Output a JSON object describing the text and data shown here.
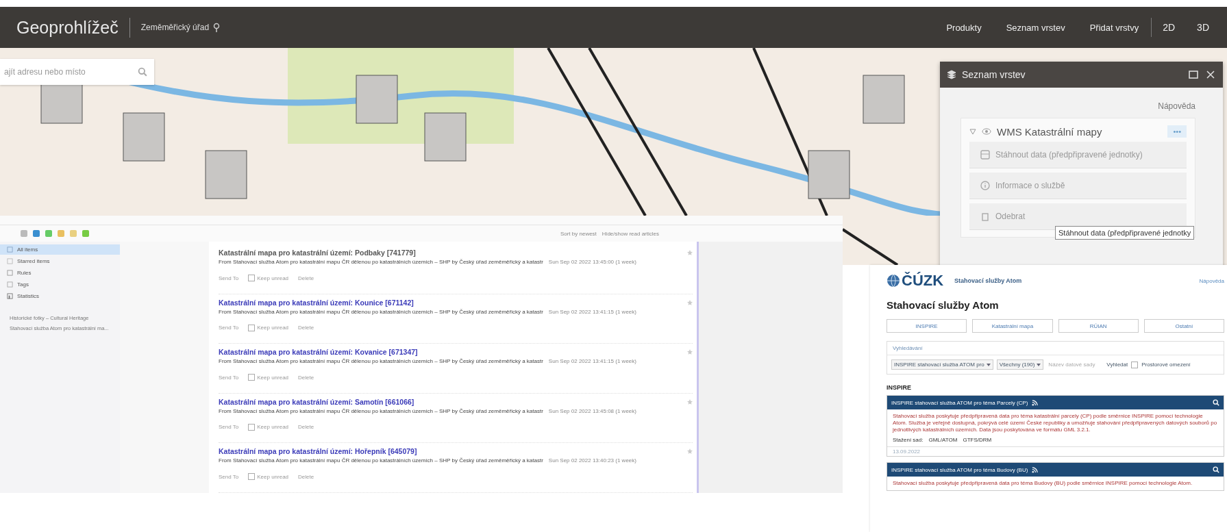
{
  "map_app": {
    "brand": "Geoprohlížeč",
    "organization": "Zeměměřický úřad",
    "nav": [
      {
        "label": "Produkty"
      },
      {
        "label": "Seznam vrstev"
      },
      {
        "label": "Přidat vrstvy"
      }
    ],
    "view_modes": [
      {
        "label": "2D"
      },
      {
        "label": "3D"
      }
    ],
    "search": {
      "placeholder": "ajít adresu nebo místo"
    }
  },
  "layer_panel": {
    "title": "Seznam vrstev",
    "help": "Nápověda",
    "layer": {
      "name": "WMS Katastrální mapy",
      "expanded": true,
      "visible": true,
      "more": "•••"
    },
    "menu": [
      {
        "kind": "download",
        "label": "Stáhnout data (předpřipravené jednotky)"
      },
      {
        "kind": "info",
        "label": "Informace o službě"
      },
      {
        "kind": "remove",
        "label": "Odebrat"
      }
    ],
    "tooltip": "Stáhnout data (předpřipravené jednotky"
  },
  "feed_reader": {
    "toolbar": {
      "sort": "Sort by newest",
      "filter": "Hide/show read articles"
    },
    "sidebar": [
      {
        "kind": "all",
        "label": "All items",
        "selected": true
      },
      {
        "kind": "starred",
        "label": "Starred items",
        "selected": false
      },
      {
        "kind": "rules",
        "label": "Rules",
        "selected": false
      },
      {
        "kind": "tags",
        "label": "Tags",
        "selected": false
      },
      {
        "kind": "stats",
        "label": "Statistics",
        "selected": false
      }
    ],
    "feeds": [
      {
        "label": "Historické fotky – Cultural Heritage"
      },
      {
        "label": "Stahovací služba Atom pro katastrální ma..."
      }
    ],
    "articles": [
      {
        "title": "Katastrální mapa pro katastrální území: Podbaky [741779]",
        "read": true,
        "source": "From Stahovací služba Atom pro katastrální mapu ČR dělenou po katastrálních územích – SHP by Český úřad zeměměřický a katastr",
        "date": "Sun Sep 02 2022 13:45:00 (1 week)",
        "actions": [
          "Send To",
          "Keep unread",
          "Delete"
        ]
      },
      {
        "title": "Katastrální mapa pro katastrální území: Kounice [671142]",
        "read": false,
        "source": "From Stahovací služba Atom pro katastrální mapu ČR dělenou po katastrálních územích – SHP by Český úřad zeměměřický a katastr",
        "date": "Sun Sep 02 2022 13:41:15 (1 week)",
        "actions": [
          "Send To",
          "Keep unread",
          "Delete"
        ]
      },
      {
        "title": "Katastrální mapa pro katastrální území: Kovanice [671347]",
        "read": false,
        "source": "From Stahovací služba Atom pro katastrální mapu ČR dělenou po katastrálních územích – SHP by Český úřad zeměměřický a katastr",
        "date": "Sun Sep 02 2022 13:41:15 (1 week)",
        "actions": [
          "Send To",
          "Keep unread",
          "Delete"
        ]
      },
      {
        "title": "Katastrální mapa pro katastrální území: Samotín [661066]",
        "read": false,
        "source": "From Stahovací služba Atom pro katastrální mapu ČR dělenou po katastrálních územích – SHP by Český úřad zeměměřický a katastr",
        "date": "Sun Sep 02 2022 13:45:08 (1 week)",
        "actions": [
          "Send To",
          "Keep unread",
          "Delete"
        ]
      },
      {
        "title": "Katastrální mapa pro katastrální území: Hořepník [645079]",
        "read": false,
        "source": "From Stahovací služba Atom pro katastrální mapu ČR dělenou po katastrálních územích – SHP by Český úřad zeměměřický a katastr",
        "date": "Sun Sep 02 2022 13:40:23 (1 week)",
        "actions": [
          "Send To",
          "Keep unread",
          "Delete"
        ]
      }
    ]
  },
  "atom_portal": {
    "logo": "ČÚZK",
    "site_title": "Stahovací služby Atom",
    "help": "Nápověda",
    "heading": "Stahovací služby Atom",
    "categories": [
      {
        "label": "INSPIRE"
      },
      {
        "label": "Katastrální mapa"
      },
      {
        "label": "RÚIAN"
      },
      {
        "label": "Ostatní"
      }
    ],
    "search": {
      "title": "Vyhledávání",
      "service": "INSPIRE stahovací služba ATOM pro",
      "count": "Všechny (190)",
      "placeholder": "Název datové sady",
      "button": "Vyhledat",
      "spatial_label": "Prostorové omezení",
      "spatial_checked": false
    },
    "section": "INSPIRE",
    "cards": [
      {
        "title": "INSPIRE stahovací služba ATOM pro téma Parcely (CP)",
        "body": "Stahovací služba poskytuje předpřipravená data pro téma katastrální parcely (CP) podle směrnice INSPIRE pomocí technologie Atom. Služba je veřejně dostupná, pokrývá celé území České republiky a umožňuje stahování předpřipravených datových souborů po jednotlivých katastrálních územích. Data jsou poskytována ve formátu GML 3.2.1.",
        "formats_label": "Stažení sad:",
        "formats": [
          "GML/ATOM",
          "GTFS/DRM"
        ],
        "updated": "13.09.2022"
      },
      {
        "title": "INSPIRE stahovací služba ATOM pro téma Budovy (BU)",
        "body": "Stahovací služba poskytuje předpřipravená data pro téma Budovy (BU) podle směrnice INSPIRE pomocí technologie Atom."
      }
    ]
  }
}
